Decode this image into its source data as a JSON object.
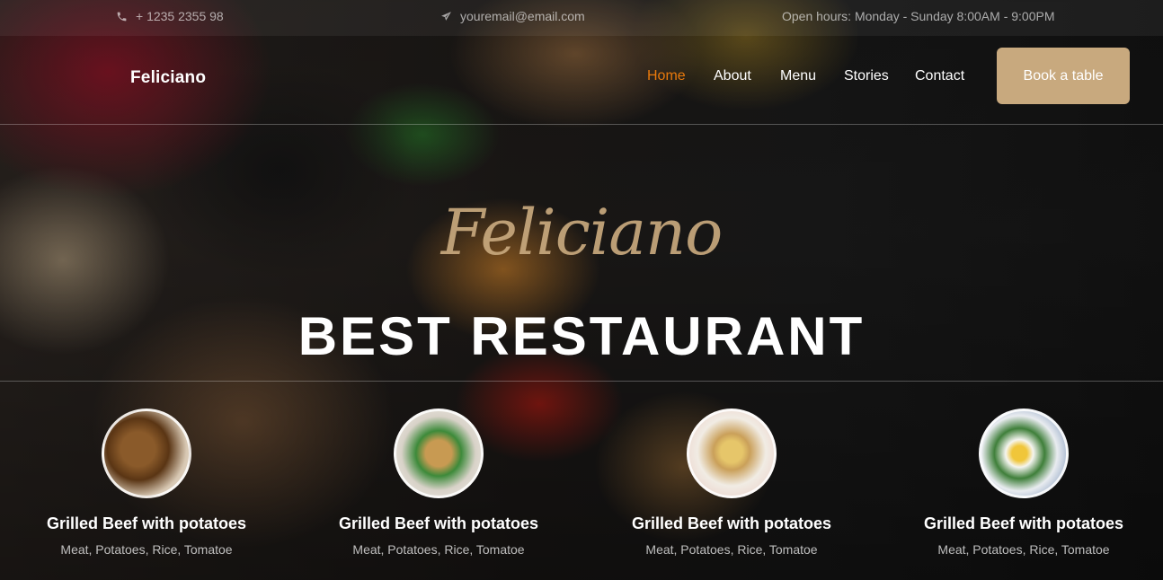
{
  "topbar": {
    "phone": "+ 1235 2355 98",
    "email": "youremail@email.com",
    "hours": "Open hours: Monday - Sunday 8:00AM - 9:00PM"
  },
  "nav": {
    "brand": "Feliciano",
    "links": [
      "Home",
      "About",
      "Menu",
      "Stories",
      "Contact"
    ],
    "active": "Home",
    "cta": "Book a table"
  },
  "hero": {
    "script_title": "Feliciano",
    "title": "BEST RESTAURANT"
  },
  "dishes": [
    {
      "name": "Grilled Beef with potatoes",
      "description": "Meat, Potatoes, Rice, Tomatoe"
    },
    {
      "name": "Grilled Beef with potatoes",
      "description": "Meat, Potatoes, Rice, Tomatoe"
    },
    {
      "name": "Grilled Beef with potatoes",
      "description": "Meat, Potatoes, Rice, Tomatoe"
    },
    {
      "name": "Grilled Beef with potatoes",
      "description": "Meat, Potatoes, Rice, Tomatoe"
    }
  ],
  "colors": {
    "accent": "#c8a97e",
    "active_link": "#e8790c"
  },
  "icons": {
    "phone": "phone-icon",
    "email": "paper-plane-icon"
  }
}
